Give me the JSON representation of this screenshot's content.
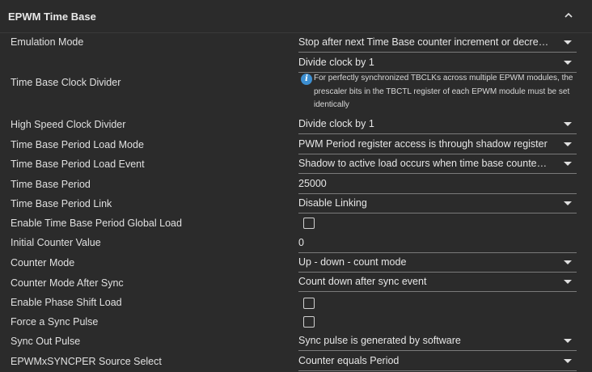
{
  "panel": {
    "title": "EPWM Time Base"
  },
  "rows": {
    "emulation_mode": {
      "label": "Emulation Mode",
      "value": "Stop after next Time Base counter increment or decrement"
    },
    "tb_clock_divider": {
      "label": "Time Base Clock Divider",
      "value": "Divide clock by 1",
      "info": "For perfectly synchronized TBCLKs across multiple EPWM modules, the prescaler bits in the TBCTL register of each EPWM module must be set identically"
    },
    "hs_clock_divider": {
      "label": "High Speed Clock Divider",
      "value": "Divide clock by 1"
    },
    "period_load_mode": {
      "label": "Time Base Period Load Mode",
      "value": "PWM Period register access is through shadow register"
    },
    "period_load_event": {
      "label": "Time Base Period Load Event",
      "value": "Shadow to active load occurs when time base counter reaches zero"
    },
    "period": {
      "label": "Time Base Period",
      "value": "25000"
    },
    "period_link": {
      "label": "Time Base Period Link",
      "value": "Disable Linking"
    },
    "period_global_load": {
      "label": "Enable Time Base Period Global Load",
      "checked": false
    },
    "initial_counter": {
      "label": "Initial Counter Value",
      "value": "0"
    },
    "counter_mode": {
      "label": "Counter Mode",
      "value": "Up - down - count mode"
    },
    "counter_mode_after_sync": {
      "label": "Counter Mode After Sync",
      "value": "Count down after sync event"
    },
    "phase_shift_load": {
      "label": "Enable Phase Shift Load",
      "checked": false
    },
    "force_sync": {
      "label": "Force a Sync Pulse",
      "checked": false
    },
    "sync_out": {
      "label": "Sync Out Pulse",
      "value": "Sync pulse is generated by software"
    },
    "syncper_source": {
      "label": "EPWMxSYNCPER Source Select",
      "value": "Counter equals Period"
    }
  },
  "colors": {
    "background": "#2b2b2b",
    "text": "#e6e6e6",
    "info_icon": "#3d8fd1",
    "underline": "#7a7a7a"
  },
  "icons": {
    "collapse": "chevron-up-icon",
    "info": "info-icon",
    "dropdown": "chevron-down-icon"
  }
}
